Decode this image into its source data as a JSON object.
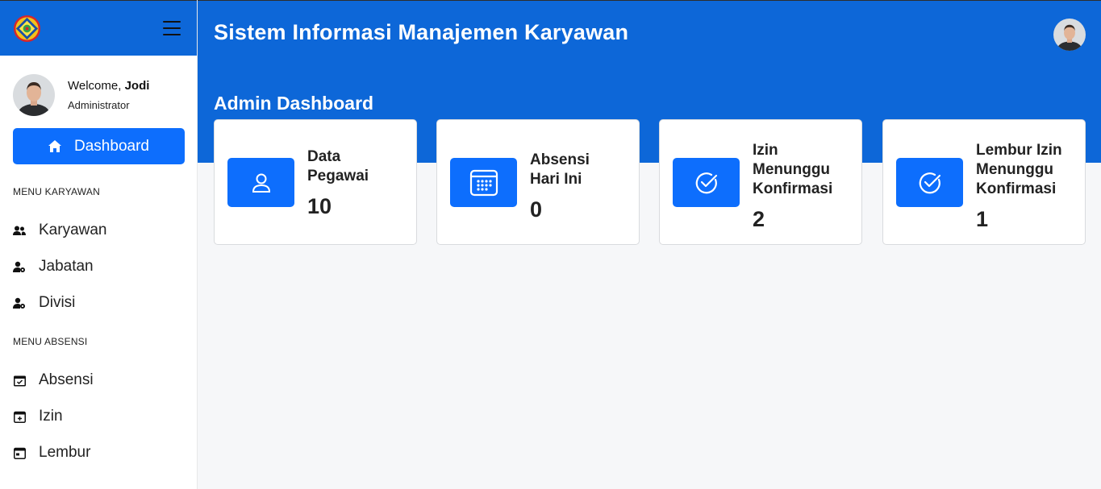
{
  "sidebar": {
    "user": {
      "welcome_prefix": "Welcome,",
      "name": "Jodi",
      "role": "Administrator"
    },
    "dashboard_label": "Dashboard",
    "sections": [
      {
        "title": "MENU KARYAWAN",
        "items": [
          {
            "label": "Karyawan",
            "icon": "users-icon"
          },
          {
            "label": "Jabatan",
            "icon": "user-gear-icon"
          },
          {
            "label": "Divisi",
            "icon": "user-gear-icon"
          }
        ]
      },
      {
        "title": "MENU ABSENSI",
        "items": [
          {
            "label": "Absensi",
            "icon": "calendar-check-icon"
          },
          {
            "label": "Izin",
            "icon": "calendar-plus-icon"
          },
          {
            "label": "Lembur",
            "icon": "calendar-icon"
          }
        ]
      }
    ]
  },
  "header": {
    "title": "Sistem Informasi Manajemen Karyawan",
    "page_title": "Admin Dashboard"
  },
  "cards": [
    {
      "label_lines": [
        "Data",
        "Pegawai"
      ],
      "value": "10",
      "icon": "user-icon"
    },
    {
      "label_lines": [
        "Absensi",
        "Hari Ini"
      ],
      "value": "0",
      "icon": "calendar-grid-icon"
    },
    {
      "label_lines": [
        "Izin",
        "Menunggu",
        "Konfirmasi"
      ],
      "value": "2",
      "icon": "check-circle-icon"
    },
    {
      "label_lines": [
        "Lembur Izin",
        "Menunggu",
        "Konfirmasi"
      ],
      "value": "1",
      "icon": "check-circle-icon"
    }
  ],
  "colors": {
    "primary": "#0d6efd",
    "header": "#0d67d8",
    "background": "#f6f7f9"
  }
}
